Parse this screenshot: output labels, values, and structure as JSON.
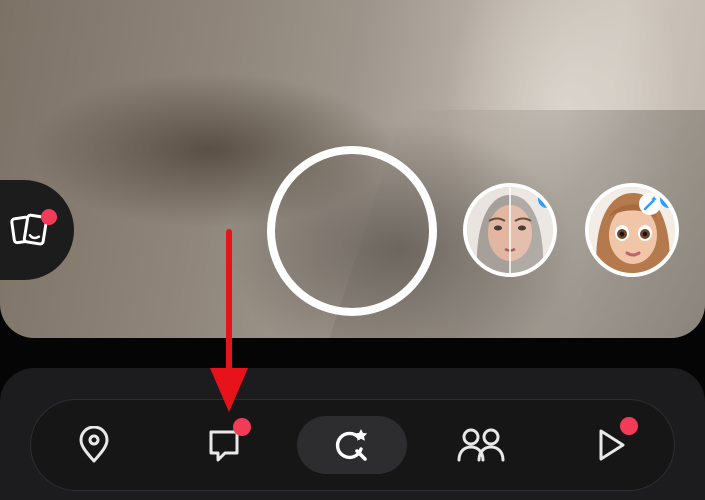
{
  "colors": {
    "notification_dot": "#f23c57",
    "lens_update_dot": "#2f9bff",
    "annotation_arrow": "#e8121b",
    "nav_background": "#1c1c1e",
    "nav_active_pill": "#2d2d2f"
  },
  "camera": {
    "capture_button": {
      "icon": "circle-shutter"
    },
    "memories": {
      "icon": "memories-cards-icon",
      "has_notification": true
    }
  },
  "lens_carousel": [
    {
      "name": "aging-split-face-lens",
      "has_update_dot": true
    },
    {
      "name": "cartoon-face-lens",
      "has_update_dot": true,
      "badge_icon": "sparkle-wand-icon"
    }
  ],
  "bottom_nav": {
    "items": [
      {
        "id": "map",
        "icon": "map-pin-icon",
        "active": false,
        "notification": false
      },
      {
        "id": "chat",
        "icon": "chat-bubble-icon",
        "active": false,
        "notification": true
      },
      {
        "id": "lenses",
        "icon": "lens-search-star-icon",
        "active": true,
        "notification": false
      },
      {
        "id": "stories",
        "icon": "friends-icon",
        "active": false,
        "notification": false
      },
      {
        "id": "spotlight",
        "icon": "play-icon",
        "active": false,
        "notification": true
      }
    ]
  },
  "annotation": {
    "type": "arrow",
    "points_to": "chat"
  }
}
